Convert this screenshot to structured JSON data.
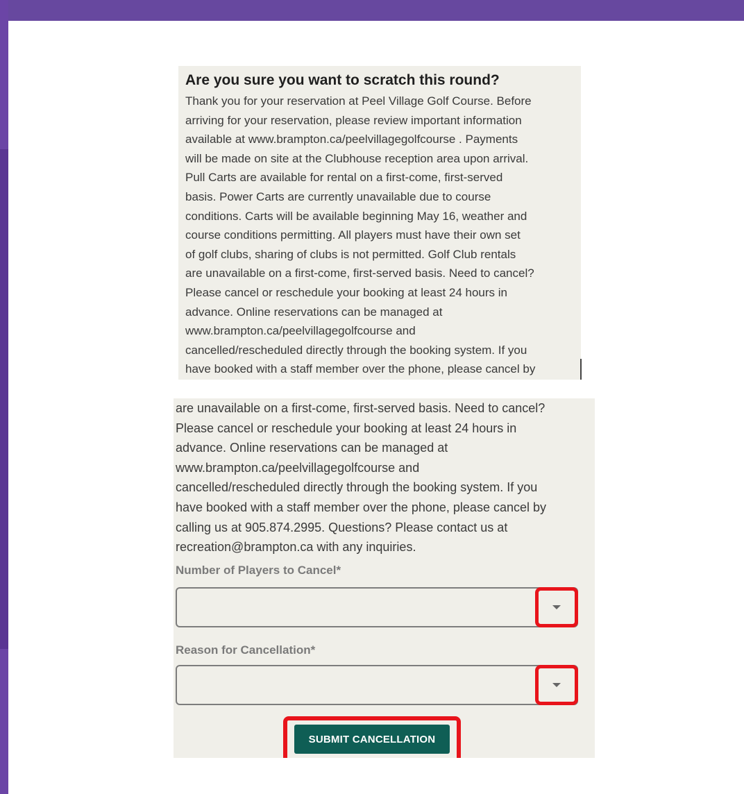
{
  "colors": {
    "header_purple": "#67489f",
    "panel_background": "#f0efe9",
    "submit_button": "#0f5e55",
    "highlight_red": "#e8141b"
  },
  "dialog": {
    "title": "Are you sure you want to scratch this round?",
    "message_top_lines": [
      "Thank you for your reservation at Peel Village Golf Course. Before",
      "arriving for your reservation, please review important information",
      "available at www.brampton.ca/peelvillagegolfcourse . Payments",
      "will be made on site at the Clubhouse reception area upon arrival.",
      "Pull Carts are available for rental on a first-come, first-served",
      "basis. Power Carts are currently unavailable due to course",
      "conditions. Carts will be available beginning May 16, weather and",
      "course conditions permitting. All players must have their own set",
      "of golf clubs, sharing of clubs is not permitted. Golf Club rentals",
      "are unavailable on a first-come, first-served basis. Need to cancel?",
      "Please cancel or reschedule your booking at least 24 hours in",
      "advance. Online reservations can be managed at",
      "www.brampton.ca/peelvillagegolfcourse and",
      "cancelled/rescheduled directly through the booking system. If you",
      "have booked with a staff member over the phone, please cancel by"
    ],
    "message_bottom_lines": [
      "are unavailable on a first-come, first-served basis. Need to cancel?",
      "Please cancel or reschedule your booking at least 24 hours in",
      "advance. Online reservations can be managed at",
      "www.brampton.ca/peelvillagegolfcourse and",
      "cancelled/rescheduled directly through the booking system. If you",
      "have booked with a staff member over the phone, please cancel by",
      "calling us at 905.874.2995. Questions? Please contact us at",
      "recreation@brampton.ca with any inquiries."
    ]
  },
  "form": {
    "players_label": "Number of Players to Cancel*",
    "players_value": "",
    "reason_label": "Reason for Cancellation*",
    "reason_value": "",
    "submit_label": "SUBMIT CANCELLATION"
  },
  "icons": {
    "dropdown": "chevron-down-icon"
  }
}
